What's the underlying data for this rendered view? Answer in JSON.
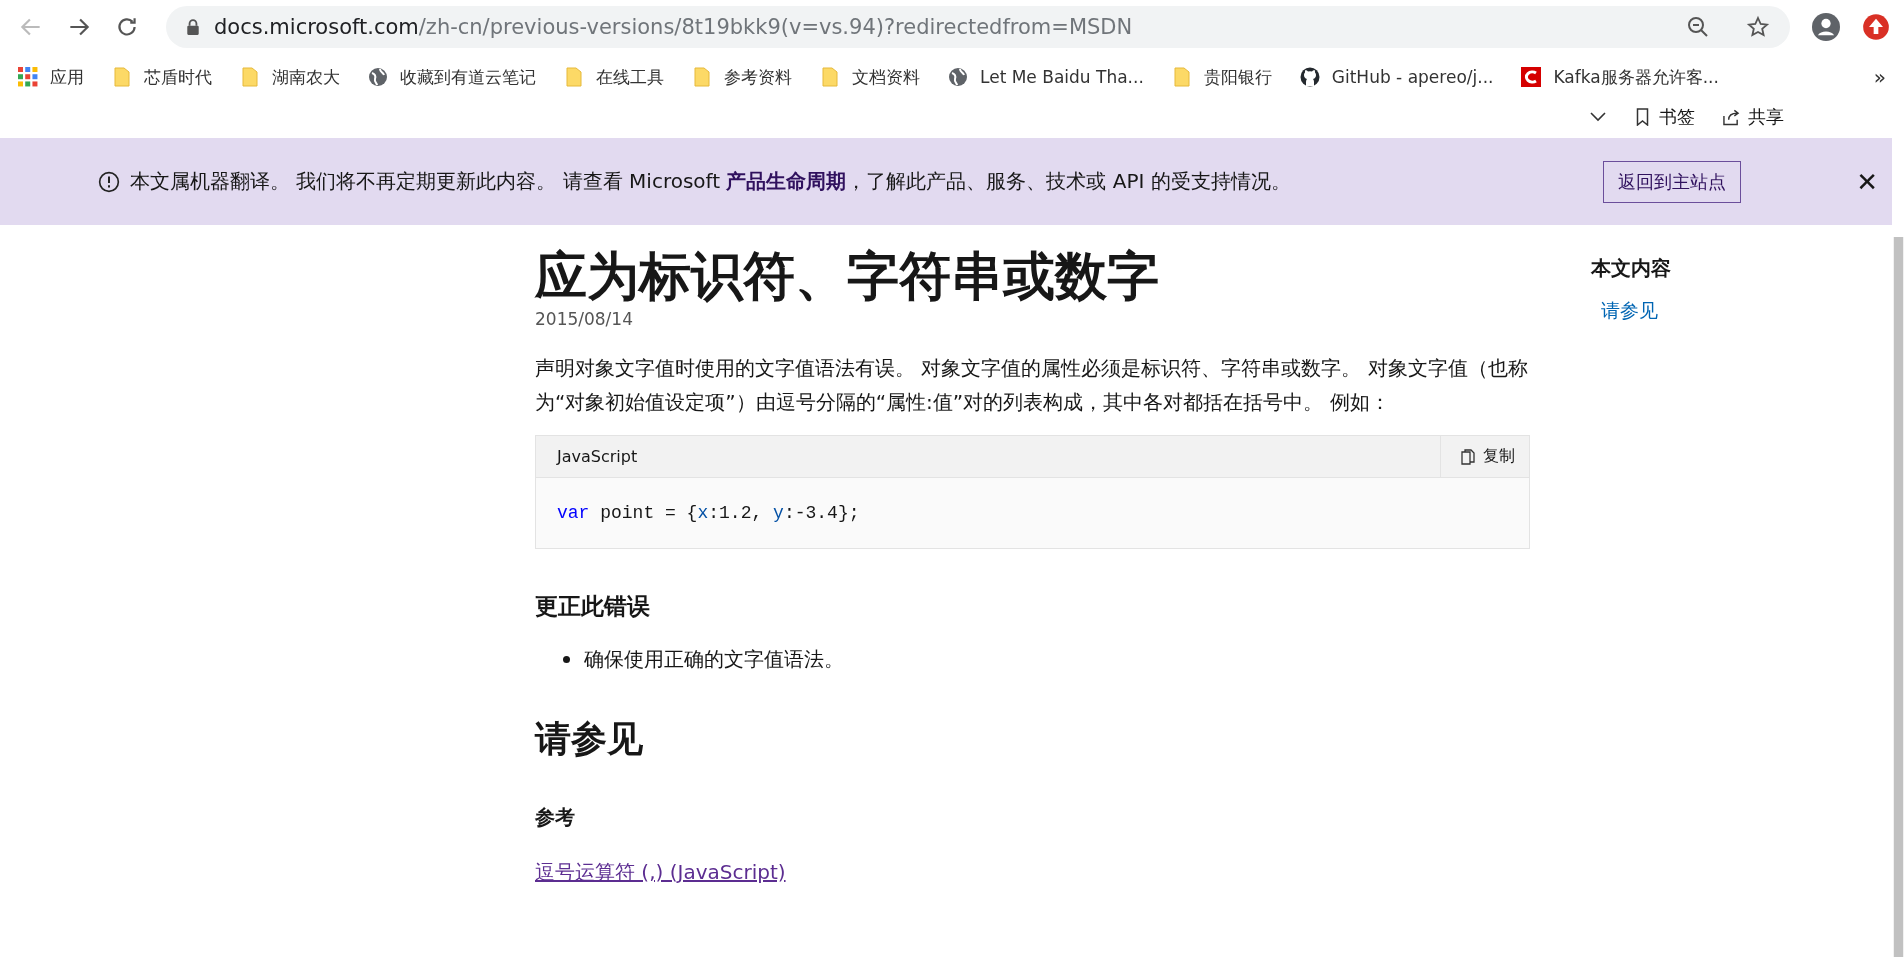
{
  "browser": {
    "url_host": "docs.microsoft.com",
    "url_path": "/zh-cn/previous-versions/8t19bkk9(v=vs.94)?redirectedfrom=MSDN"
  },
  "bookmarks": [
    {
      "kind": "apps",
      "label": "应用"
    },
    {
      "kind": "folder",
      "label": "芯盾时代"
    },
    {
      "kind": "folder",
      "label": "湖南农大"
    },
    {
      "kind": "globe",
      "label": "收藏到有道云笔记"
    },
    {
      "kind": "folder",
      "label": "在线工具"
    },
    {
      "kind": "folder",
      "label": "参考资料"
    },
    {
      "kind": "folder",
      "label": "文档资料"
    },
    {
      "kind": "globe",
      "label": "Let Me Baidu Tha..."
    },
    {
      "kind": "folder",
      "label": "贵阳银行"
    },
    {
      "kind": "github",
      "label": "GitHub - apereo/j..."
    },
    {
      "kind": "csdn",
      "label": "Kafka服务器允许客..."
    }
  ],
  "bookmarks_more": "»",
  "page_toolbar": {
    "bookmark": "书签",
    "share": "共享"
  },
  "banner": {
    "text": "本文属机器翻译。 我们将不再定期更新此内容。 请查看 Microsoft **产品生命周期**，了解此产品、服务、技术或 API 的受支持情况。",
    "button": "返回到主站点",
    "close": "✕"
  },
  "article": {
    "title": "应为标识符、字符串或数字",
    "date": "2015/08/14",
    "paragraph": "声明对象文字值时使用的文字值语法有误。 对象文字值的属性必须是标识符、字符串或数字。 对象文字值（也称为“对象初始值设定项”）由逗号分隔的“属性:值”对的列表构成，其中各对都括在括号中。 例如：",
    "code": {
      "language": "JavaScript",
      "copy": "复制",
      "tokens": [
        {
          "kind": "keyword",
          "text": "var"
        },
        {
          "kind": "plain",
          "text": " point = {"
        },
        {
          "kind": "prop",
          "text": "x"
        },
        {
          "kind": "plain",
          "text": ":1.2, "
        },
        {
          "kind": "prop",
          "text": "y"
        },
        {
          "kind": "plain",
          "text": ":-3.4};"
        }
      ]
    },
    "fix_heading": "更正此错误",
    "fix_items": [
      "确保使用正确的文字值语法。"
    ],
    "see_also_heading": "请参见",
    "reference_heading": "参考",
    "reference_link": "逗号运算符 (,) (JavaScript)"
  },
  "toc": {
    "title": "本文内容",
    "items": [
      "请参见"
    ]
  }
}
